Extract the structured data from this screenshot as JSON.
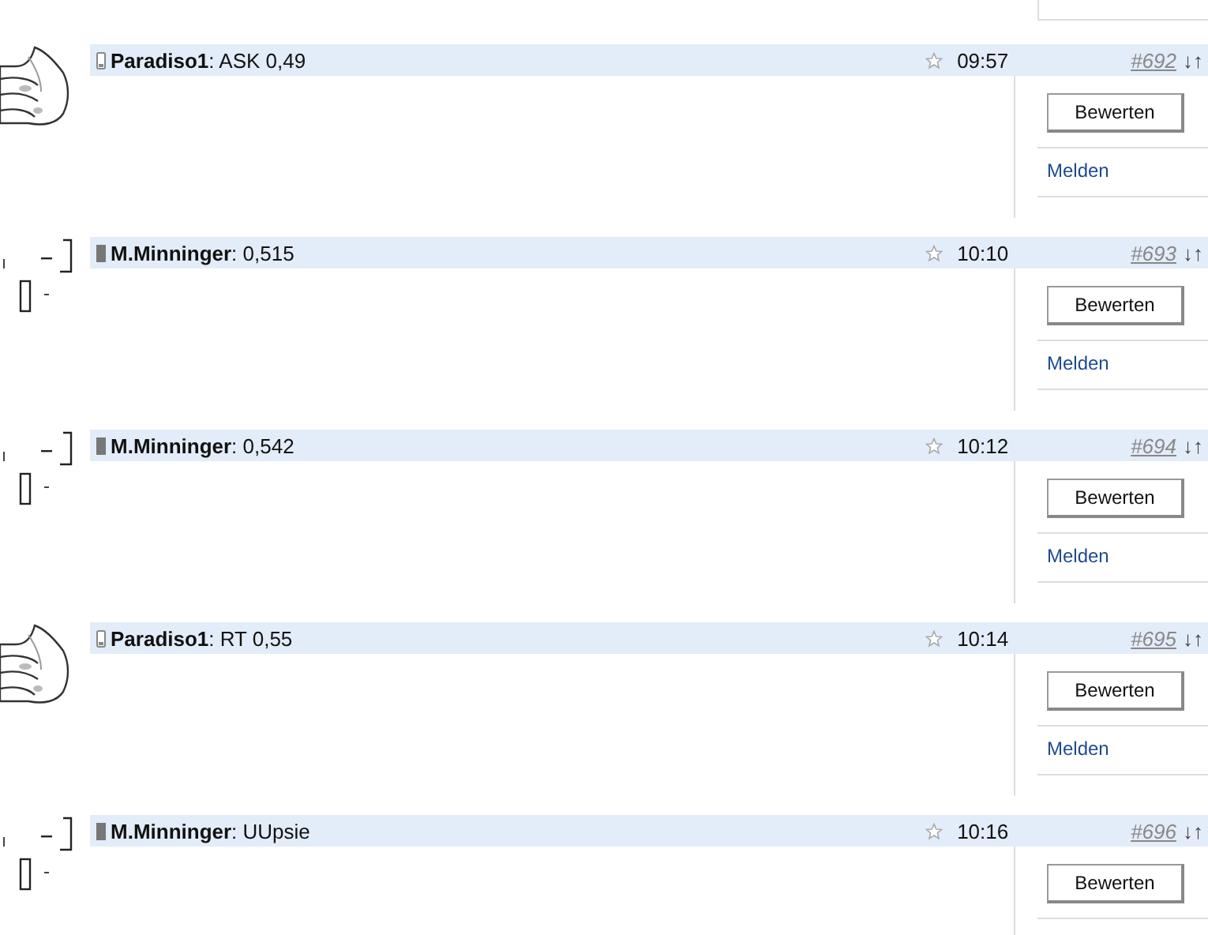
{
  "posts": [
    {
      "avatar": {
        "kind": "thumb"
      },
      "user_icon": {
        "kind": "phone"
      },
      "text": "**Paradiso1**: ASK 0,49",
      "time": "09:57",
      "number": "#692",
      "arrows": "↓↑",
      "rate_button": "Bewerten",
      "report_link": "Melden"
    },
    {
      "avatar": {
        "kind": "blocks"
      },
      "user_icon": {
        "kind": "bar"
      },
      "text": "**M.Minninger**: 0,515",
      "time": "10:10",
      "number": "#693",
      "arrows": "↓↑",
      "rate_button": "Bewerten",
      "report_link": "Melden"
    },
    {
      "avatar": {
        "kind": "blocks"
      },
      "user_icon": {
        "kind": "bar"
      },
      "text": "**M.Minninger**: 0,542",
      "time": "10:12",
      "number": "#694",
      "arrows": "↓↑",
      "rate_button": "Bewerten",
      "report_link": "Melden"
    },
    {
      "avatar": {
        "kind": "thumb"
      },
      "user_icon": {
        "kind": "phone"
      },
      "text": "**Paradiso1**: RT 0,55",
      "time": "10:14",
      "number": "#695",
      "arrows": "↓↑",
      "rate_button": "Bewerten",
      "report_link": "Melden"
    },
    {
      "avatar": {
        "kind": "blocks"
      },
      "user_icon": {
        "kind": "bar"
      },
      "text": "**M.Minninger**: UUpsie",
      "time": "10:16",
      "number": "#696",
      "arrows": "↓↑",
      "rate_button": "Bewerten"
    }
  ]
}
